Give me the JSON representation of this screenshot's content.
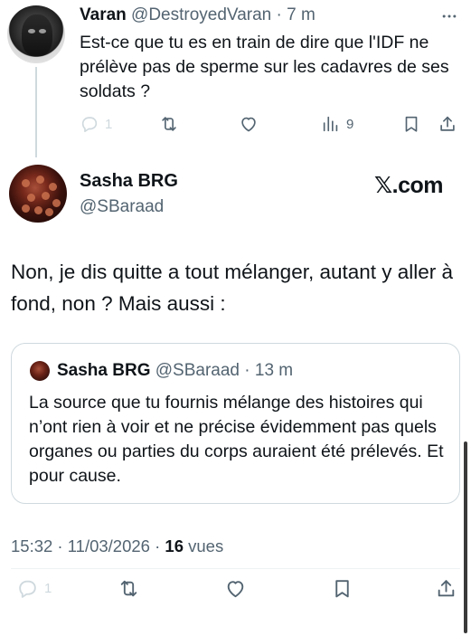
{
  "reply": {
    "name": "Varan",
    "handle": "@DestroyedVaran",
    "separator": " · ",
    "time": "7 m",
    "text": "Est-ce que tu es en train de dire que l'IDF ne prélève pas de sperme sur les cadavres de ses soldats ?",
    "actions": {
      "replies": "1",
      "views": "9"
    }
  },
  "tweet": {
    "name": "Sasha BRG",
    "handle": "@SBaraad",
    "watermark": "𝕏.com",
    "text": "Non, je dis quitte a tout mélanger, autant y aller à fond, non ? Mais aussi :",
    "quote": {
      "name": "Sasha BRG",
      "handle": "@SBaraad",
      "separator": " · ",
      "time": "13 m",
      "text": "La source que tu fournis mélange des histoires qui n’ont rien à voir et ne précise évidemment pas quels organes ou parties du corps auraient été prélevés. Et pour cause."
    },
    "time": "15:32",
    "separator": " · ",
    "date": "11/03/2026",
    "separator2": " · ",
    "views_count": "16",
    "views_label": " vues",
    "actions": {
      "replies": "1"
    }
  },
  "icons": {
    "reply": "reply-icon",
    "retweet": "retweet-icon",
    "like": "heart-icon",
    "views": "bar-chart-icon",
    "bookmark": "bookmark-icon",
    "share": "share-icon",
    "more": "more-horizontal-icon"
  },
  "colors": {
    "text_primary": "#0f1419",
    "text_secondary": "#536471",
    "reply_count_faded": "#cfd9de",
    "border": "#cfd9de"
  }
}
